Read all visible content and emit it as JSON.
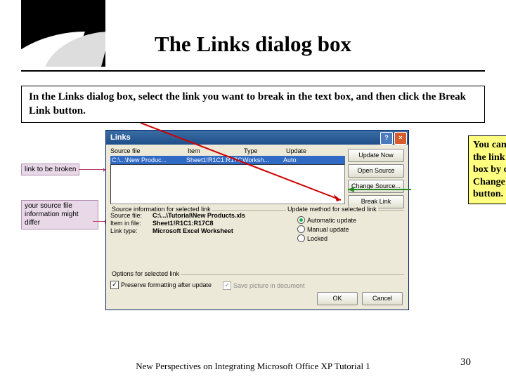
{
  "title": "The Links dialog box",
  "instruction": "In the Links dialog box, select the link you want to break in the text box, and then click the Break Link button.",
  "callout": "You can also modify the link in this dialog box by clicking the Change Source button.",
  "annotations": {
    "link_to_break": "link to be broken",
    "source_info": "your source file information might differ"
  },
  "dialog": {
    "title": "Links",
    "columns": [
      "Source file",
      "Item",
      "Type",
      "Update"
    ],
    "row": {
      "source": "C:\\...\\New Produc...",
      "item": "Sheet1!R1C1:R17C8",
      "type": "Worksh...",
      "update": "Auto"
    },
    "buttons": {
      "update_now": "Update Now",
      "open_source": "Open Source",
      "change_source": "Change Source...",
      "break_link": "Break Link"
    },
    "group_source": "Source information for selected link",
    "group_update": "Update method for selected link",
    "src": {
      "file_label": "Source file:",
      "file_value": "C:\\...\\Tutorial\\New Products.xls",
      "item_label": "Item in file:",
      "item_value": "Sheet1!R1C1:R17C8",
      "type_label": "Link type:",
      "type_value": "Microsoft Excel Worksheet"
    },
    "update": {
      "auto": "Automatic update",
      "manual": "Manual update",
      "locked": "Locked"
    },
    "group_options": "Options for selected link",
    "checks": {
      "preserve": "Preserve formatting after update",
      "savepic": "Save picture in document"
    },
    "ok": "OK",
    "cancel": "Cancel"
  },
  "footer": "New Perspectives on Integrating Microsoft Office XP Tutorial 1",
  "page": "30"
}
